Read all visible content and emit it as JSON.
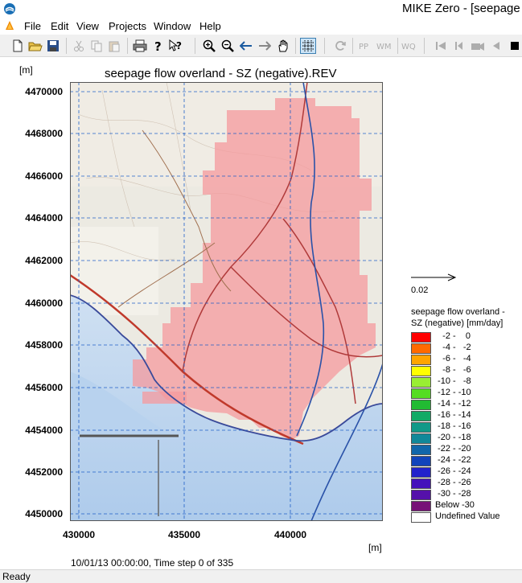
{
  "window": {
    "title": "MIKE Zero - [seepage f"
  },
  "menu": [
    "File",
    "Edit",
    "View",
    "Projects",
    "Window",
    "Help"
  ],
  "icons": {
    "new": "new-file-icon",
    "open": "open-folder-icon",
    "save": "save-icon",
    "cut": "cut-icon",
    "copy": "copy-icon",
    "paste": "paste-icon",
    "print": "printer-icon",
    "help": "help-icon",
    "context_help": "context-help-icon",
    "zoom_in": "zoom-in-icon",
    "zoom_out": "zoom-out-icon",
    "pan": "hand-icon",
    "grid": "grid-icon"
  },
  "plot": {
    "title": "seepage flow overland - SZ (negative).REV",
    "y_unit": "[m]",
    "x_unit": "[m]",
    "y_ticks": [
      "4470000",
      "4468000",
      "4466000",
      "4464000",
      "4462000",
      "4460000",
      "4458000",
      "4456000",
      "4454000",
      "4452000",
      "4450000"
    ],
    "x_ticks": [
      "430000",
      "435000",
      "440000"
    ],
    "time_label": "10/01/13 00:00:00, Time step 0 of 335",
    "vector_scale": "0.02"
  },
  "legend": {
    "title_line1": "seepage flow overland -",
    "title_line2": "SZ (negative) [mm/day]",
    "items": [
      {
        "label": "   -2 -    0",
        "color": "#ff0000"
      },
      {
        "label": "   -4 -   -2",
        "color": "#ff6a00"
      },
      {
        "label": "   -6 -   -4",
        "color": "#ffa500"
      },
      {
        "label": "   -8 -   -6",
        "color": "#ffff00"
      },
      {
        "label": " -10 -   -8",
        "color": "#99ee33"
      },
      {
        "label": " -12 - -10",
        "color": "#55dd22"
      },
      {
        "label": " -14 - -12",
        "color": "#22bb33"
      },
      {
        "label": " -16 - -14",
        "color": "#11aa66"
      },
      {
        "label": " -18 - -16",
        "color": "#119988"
      },
      {
        "label": " -20 - -18",
        "color": "#118899"
      },
      {
        "label": " -22 - -20",
        "color": "#1166aa"
      },
      {
        "label": " -24 - -22",
        "color": "#1144bb"
      },
      {
        "label": " -26 - -24",
        "color": "#2222cc"
      },
      {
        "label": " -28 - -26",
        "color": "#4411bb"
      },
      {
        "label": " -30 - -28",
        "color": "#5511aa"
      },
      {
        "label": "Below -30",
        "color": "#771177"
      },
      {
        "label": "Undefined Value",
        "color": "#ffffff"
      }
    ]
  },
  "status": {
    "text": "Ready"
  }
}
